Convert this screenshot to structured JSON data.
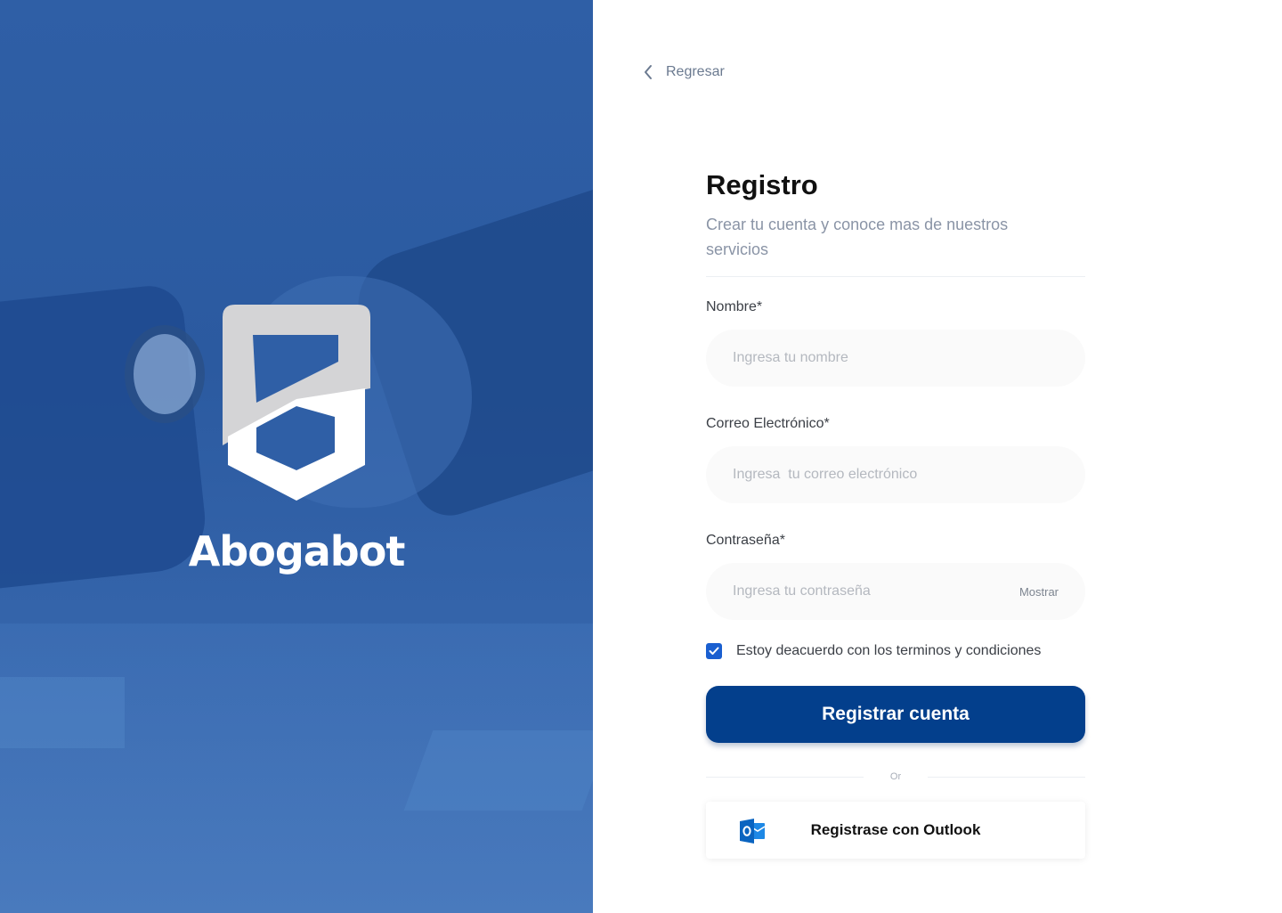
{
  "brand": {
    "name": "Abogabot"
  },
  "nav": {
    "back_label": "Regresar"
  },
  "form": {
    "title": "Registro",
    "subtitle": "Crear tu cuenta y conoce mas de nuestros servicios",
    "fields": [
      {
        "label": "Nombre*",
        "placeholder": "Ingresa tu nombre",
        "value": ""
      },
      {
        "label": "Correo Electrónico*",
        "placeholder": "Ingresa  tu correo electrónico",
        "value": ""
      },
      {
        "label": "Contraseña*",
        "placeholder": "Ingresa tu contraseña",
        "value": "",
        "toggle_label": "Mostrar"
      }
    ],
    "terms_label": "Estoy deacuerdo con los terminos y condiciones",
    "terms_checked": true,
    "submit_label": "Registrar cuenta",
    "or_label": "Or",
    "outlook_label": "Registrase con Outlook"
  },
  "colors": {
    "primary": "#033f8c",
    "hero_overlay": "#2f5fa6",
    "checkbox": "#1a5fd0",
    "outlook_blue": "#0a64c0"
  }
}
